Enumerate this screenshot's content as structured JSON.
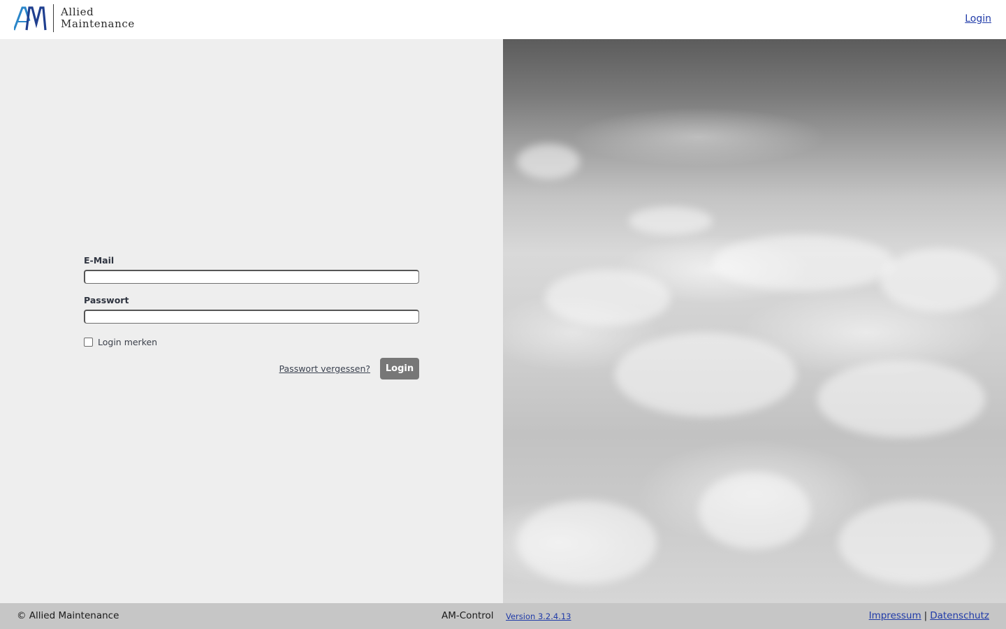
{
  "header": {
    "logo_mark": "AM",
    "logo_line1": "Allied",
    "logo_line2": "Maintenance",
    "login_link": "Login"
  },
  "form": {
    "email_label": "E-Mail",
    "email_value": "",
    "password_label": "Passwort",
    "password_value": "",
    "remember_label": "Login merken",
    "remember_checked": false,
    "forgot_link": "Passwort vergessen?",
    "login_button": "Login"
  },
  "footer": {
    "copyright": "© Allied Maintenance",
    "product": "AM-Control",
    "version": "Version 3.2.4.13",
    "impressum": "Impressum",
    "separator": "|",
    "datenschutz": "Datenschutz"
  },
  "colors": {
    "link": "#1f3aa8",
    "button_bg": "#777777",
    "footer_bg": "#c6c6c6",
    "panel_bg": "#eeeeee",
    "logo_blue": "#1f4f9c"
  },
  "background_image": "cloudscape-grayscale"
}
